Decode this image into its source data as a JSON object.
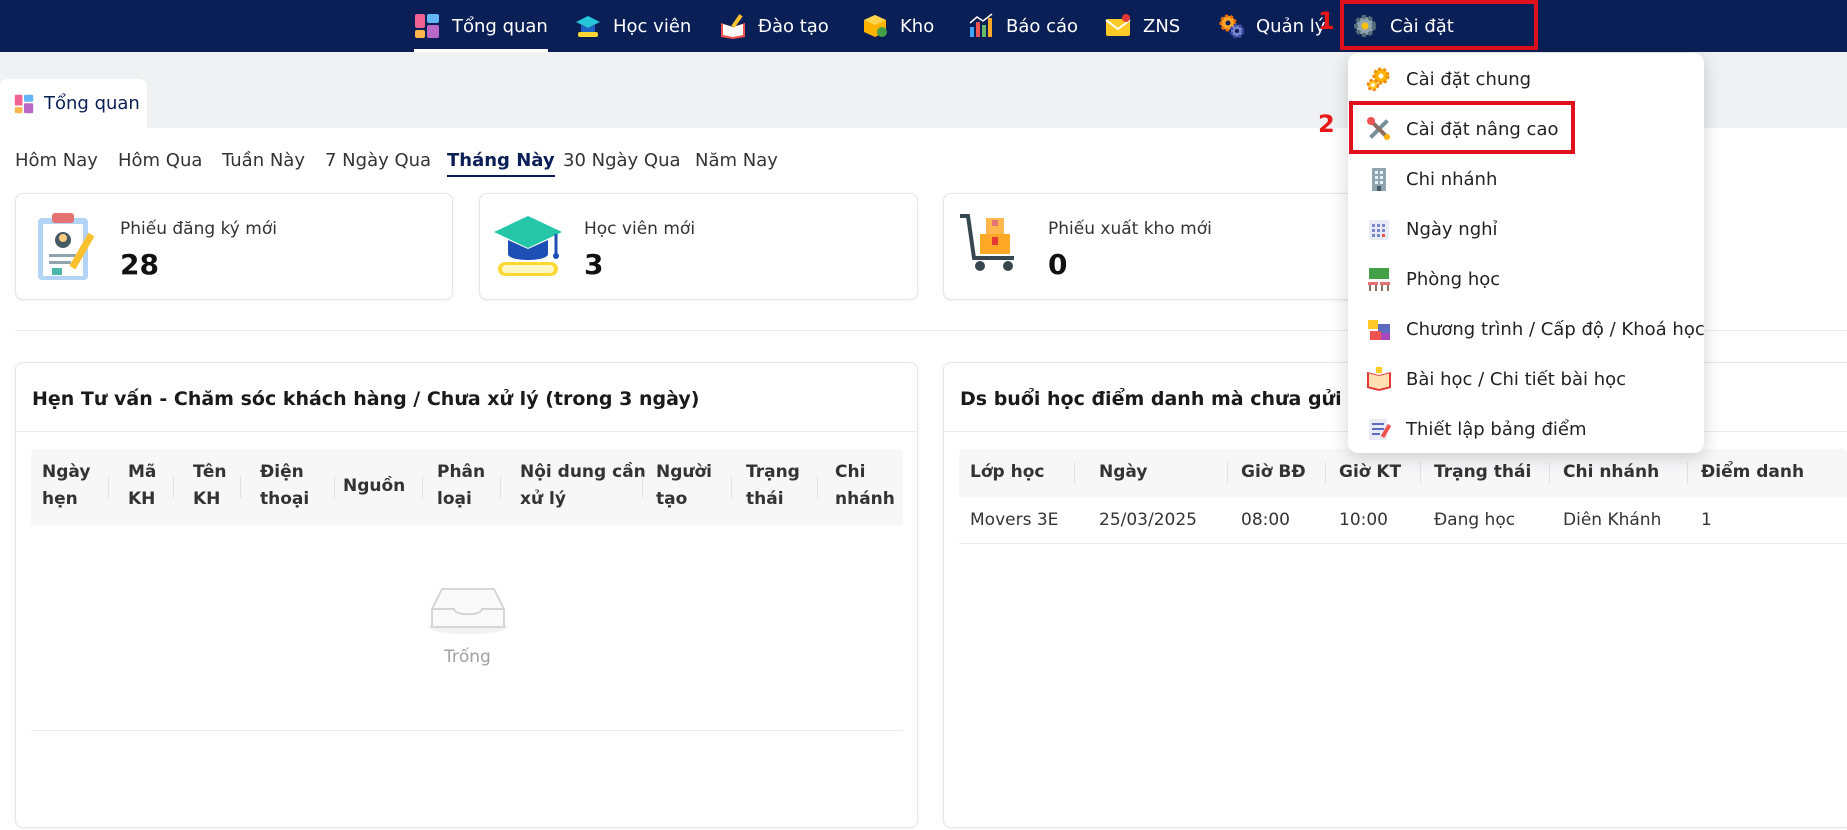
{
  "nav": {
    "items": [
      {
        "label": "Tổng quan",
        "icon": "dashboard-icon"
      },
      {
        "label": "Học viên",
        "icon": "graduation-cap-icon"
      },
      {
        "label": "Đào tạo",
        "icon": "book-pen-icon"
      },
      {
        "label": "Kho",
        "icon": "box-icon"
      },
      {
        "label": "Báo cáo",
        "icon": "bar-chart-icon"
      },
      {
        "label": "ZNS",
        "icon": "mail-icon"
      },
      {
        "label": "Quản lý",
        "icon": "gears-icon"
      },
      {
        "label": "Cài đặt",
        "icon": "gear-icon"
      }
    ],
    "active": "Tổng quan",
    "step1": "1",
    "step2": "2"
  },
  "tab": {
    "label": "Tổng quan",
    "icon": "dashboard-icon"
  },
  "filters": [
    "Hôm Nay",
    "Hôm Qua",
    "Tuần Này",
    "7 Ngày Qua",
    "Tháng Này",
    "30 Ngày Qua",
    "Năm Nay"
  ],
  "active_filter": "Tháng Này",
  "stats": [
    {
      "label": "Phiếu đăng ký mới",
      "value": "28",
      "icon": "clipboard-icon"
    },
    {
      "label": "Học viên mới",
      "value": "3",
      "icon": "graduation-cap-icon"
    },
    {
      "label": "Phiếu xuất kho mới",
      "value": "0",
      "icon": "cart-boxes-icon"
    }
  ],
  "left_panel": {
    "title": "Hẹn Tư vấn - Chăm sóc khách hàng / Chưa xử lý (trong 3 ngày)",
    "columns": [
      [
        "Ngày",
        "hẹn"
      ],
      [
        "Mã",
        "KH"
      ],
      [
        "Tên",
        "KH"
      ],
      [
        "Điện",
        "thoại"
      ],
      [
        "Nguồn"
      ],
      [
        "Phân",
        "loại"
      ],
      [
        "Nội dung cần",
        "xử lý"
      ],
      [
        "Người",
        "tạo"
      ],
      [
        "Trạng",
        "thái"
      ],
      [
        "Chi",
        "nhánh"
      ]
    ],
    "empty_text": "Trống"
  },
  "right_panel": {
    "title": "Ds buổi học điểm danh mà chưa gửi ZNS",
    "columns": [
      "Lớp học",
      "Ngày",
      "Giờ BĐ",
      "Giờ KT",
      "Trạng thái",
      "Chi nhánh",
      "Điểm danh"
    ],
    "rows": [
      [
        "Movers 3E",
        "25/03/2025",
        "08:00",
        "10:00",
        "Đang học",
        "Diên Khánh",
        "1"
      ]
    ]
  },
  "dropdown": {
    "items": [
      {
        "label": "Cài đặt chung",
        "icon": "gears-icon"
      },
      {
        "label": "Cài đặt nâng cao",
        "icon": "tools-icon"
      },
      {
        "label": "Chi nhánh",
        "icon": "building-icon"
      },
      {
        "label": "Ngày nghỉ",
        "icon": "calendar-icon"
      },
      {
        "label": "Phòng học",
        "icon": "classroom-icon"
      },
      {
        "label": "Chương trình / Cấp độ / Khoá học",
        "icon": "blocks-icon"
      },
      {
        "label": "Bài học / Chi tiết bài học",
        "icon": "lesson-book-icon"
      },
      {
        "label": "Thiết lập bảng điểm",
        "icon": "scoreboard-icon"
      }
    ]
  },
  "colors": {
    "nav_bg": "#0a1f56",
    "highlight": "#e0101c",
    "accent": "#0a1f56"
  }
}
